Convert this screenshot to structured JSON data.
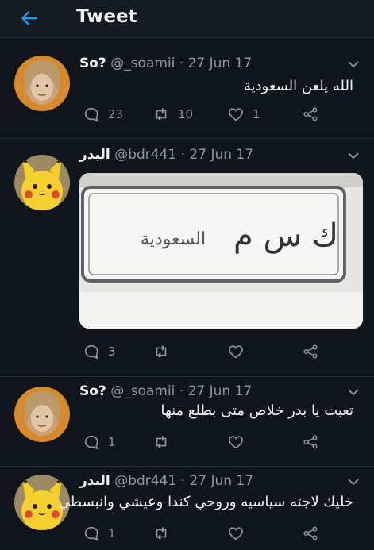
{
  "header": {
    "title": "Tweet",
    "back_icon": "arrow-left-icon"
  },
  "colors": {
    "background": "#10151c",
    "accent": "#1d9bf0",
    "secondary_text": "#8b98a5"
  },
  "tweets": [
    {
      "display_name": "So?",
      "handle": "@_soamii",
      "date": "· 27 Jun 17",
      "text": "الله يلعن السعودية",
      "replies": "23",
      "retweets": "10",
      "likes": "1"
    },
    {
      "display_name": "البدر",
      "handle": "@bdr441",
      "date": "· 27 Jun 17",
      "text": "",
      "replies": "3",
      "retweets": "",
      "likes": "",
      "media": {
        "plate_text": "السعودية",
        "plate_letters": "ك س م"
      }
    },
    {
      "display_name": "So?",
      "handle": "@_soamii",
      "date": "· 27 Jun 17",
      "text": "تعبت يا بدر خلاص متى بطلع منها",
      "replies": "1",
      "retweets": "",
      "likes": ""
    },
    {
      "display_name": "البدر",
      "handle": "@bdr441",
      "date": "· 27 Jun 17",
      "text": "خليك لاجئه سياسيه وروحي كندا وعيشي وانبسطي",
      "replies": "1",
      "retweets": "",
      "likes": ""
    }
  ]
}
